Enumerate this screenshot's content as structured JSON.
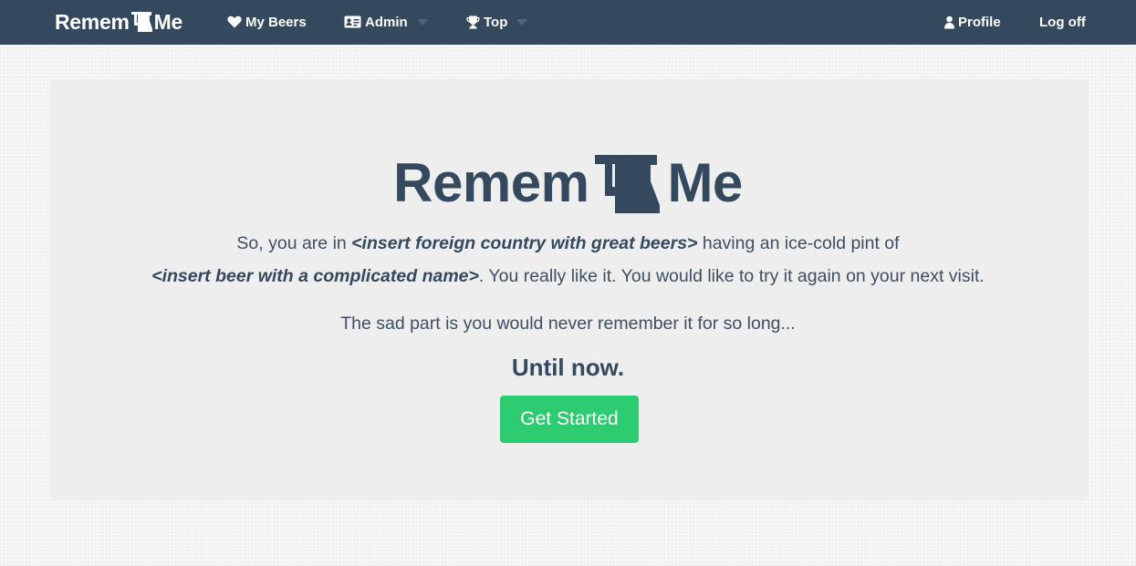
{
  "navbar": {
    "brand": {
      "part1": "Remem",
      "part2": "Me",
      "icon": "beer-mug-icon"
    },
    "items": [
      {
        "label": "My Beers",
        "icon": "heart-icon"
      },
      {
        "label": "Admin",
        "icon": "id-card-icon",
        "dropdown": true
      },
      {
        "label": "Top",
        "icon": "trophy-icon",
        "dropdown": true
      }
    ],
    "right_items": [
      {
        "label": "Profile",
        "icon": "user-icon"
      },
      {
        "label": "Log off"
      }
    ]
  },
  "hero": {
    "title_part1": "Remem",
    "title_part2": "Me",
    "line1_pre": "So, you are in ",
    "line1_em": "<insert foreign country with great beers>",
    "line1_post": " having an ice-cold pint of",
    "line2_em": "<insert beer with a complicated name>",
    "line2_post": ". You really like it. You would like to try it again on your next visit.",
    "line3": "The sad part is you would never remember it for so long...",
    "until": "Until now.",
    "cta_label": "Get Started"
  },
  "colors": {
    "navbar": "#34495e",
    "text": "#34495e",
    "jumbotron": "#eeeeee",
    "cta": "#2ecc71"
  }
}
